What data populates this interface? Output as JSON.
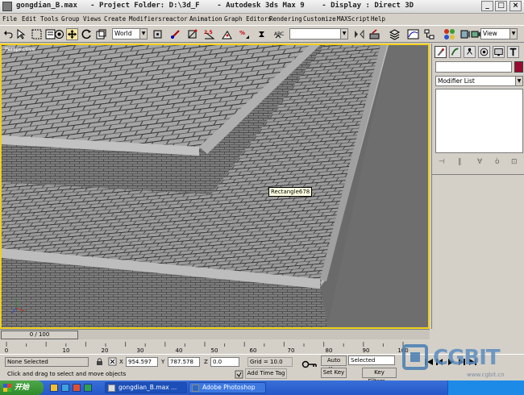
{
  "window": {
    "title": "gongdian_B.max   - Project Folder: D:\\3d_F    - Autodesk 3ds Max 9    - Display : Direct 3D"
  },
  "menu": [
    "File",
    "Edit",
    "Tools",
    "Group",
    "Views",
    "Create",
    "Modifiers",
    "reactor",
    "Animation",
    "Graph Editors",
    "Rendering",
    "Customize",
    "MAXScript",
    "Help"
  ],
  "toolbar": {
    "coord_system": "World",
    "selection_set": "",
    "view_mode": "View"
  },
  "viewport": {
    "label": "Perspective",
    "tooltip": "Rectangle678"
  },
  "command_panel": {
    "name_value": "",
    "object_color": "#9b0a2e",
    "modifier_list": "Modifier List"
  },
  "timeline": {
    "slider_label": "0 / 100",
    "ticks": [
      "0",
      "10",
      "20",
      "30",
      "40",
      "50",
      "60",
      "70",
      "80",
      "90",
      "100"
    ]
  },
  "status": {
    "selection": "None Selected",
    "x_label": "X",
    "x_value": "954.597",
    "y_label": "Y",
    "y_value": "787.578",
    "z_label": "Z",
    "z_value": "0.0",
    "grid": "Grid = 10.0",
    "auto_key": "Auto Key",
    "selected": "Selected",
    "set_key": "Set Key",
    "key_filters": "Key Filters...",
    "prompt": "Click and drag to select and move objects",
    "add_time_tag": "Add Time Tag"
  },
  "taskbar": {
    "start": "开始",
    "tasks": [
      "gongdian_B.max ...",
      "Adobe Photoshop"
    ]
  },
  "watermark": {
    "brand": "CGBIT",
    "site": "www.cgbit.cn"
  },
  "colors": {
    "active_viewport_border": "#f0d020",
    "taskbar_blue": "#2457c8",
    "start_green": "#3a9a34"
  }
}
